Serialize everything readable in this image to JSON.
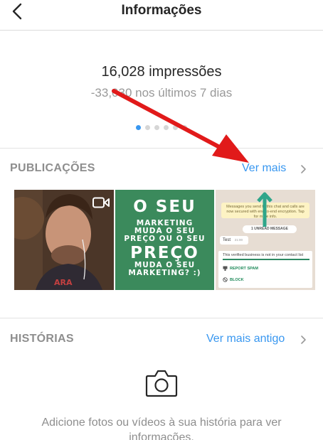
{
  "header": {
    "title": "Informações"
  },
  "summary": {
    "impressions": "16,028 impressões",
    "delta": "-33,030 nos últimos 7 dias",
    "pager": {
      "count": 6,
      "active_index": 0
    }
  },
  "publicacoes": {
    "label": "PUBLICAÇÕES",
    "link": "Ver mais",
    "posts": [
      {
        "kind": "video",
        "icon": "video-camera-icon"
      },
      {
        "kind": "image",
        "lines": [
          "O SEU",
          "MARKETING",
          "MUDA O SEU",
          "PREÇO OU O SEU",
          "PREÇO",
          "MUDA O SEU",
          "MARKETING? :)"
        ]
      },
      {
        "kind": "image",
        "banner": "Messages you send to this chat and calls are now secured with end-to-end encryption. Tap for more info.",
        "unread": "1 UNREAD MESSAGE",
        "bubble_text": "Test",
        "bubble_time": "21:00",
        "card_notice": "This verified business is not in your contact list",
        "report": "REPORT SPAM",
        "block": "BLOCK"
      }
    ]
  },
  "historias": {
    "label": "HISTÓRIAS",
    "link": "Ver mais antigo",
    "empty_text": "Adicione fotos ou vídeos à sua história para ver informações."
  },
  "colors": {
    "link": "#3897f0",
    "muted": "#8e8e8e",
    "annotation": "#e11a1a"
  }
}
